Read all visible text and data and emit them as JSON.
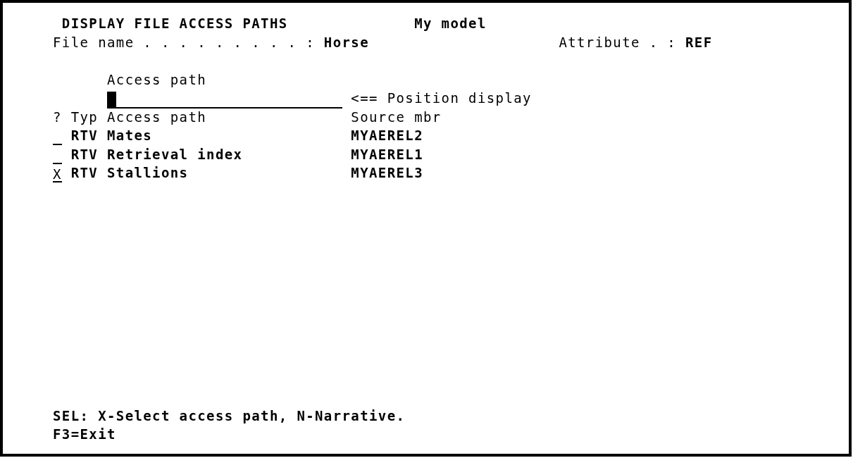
{
  "screen": {
    "title": "DISPLAY FILE ACCESS PATHS",
    "model": "My model"
  },
  "file_name": {
    "label": "File name . . . . . . . . . :",
    "value": "Horse"
  },
  "attribute": {
    "label": "Attribute . :",
    "value": "REF"
  },
  "position": {
    "label": "Access path",
    "focused": true,
    "hint": "<== Position display"
  },
  "table": {
    "columns": [
      "?",
      "Typ",
      "Access path",
      "Source mbr"
    ],
    "rows": [
      {
        "type": "RTV",
        "access_path": "Mates",
        "source_member": "MYAEREL2"
      },
      {
        "type": "RTV",
        "access_path": "Retrieval index",
        "source_member": "MYAEREL1"
      },
      {
        "option": "X",
        "type": "RTV",
        "access_path": "Stallions",
        "source_member": "MYAEREL3"
      }
    ]
  },
  "footer": {
    "help": "SEL: X-Select access path, N-Narrative.",
    "keys": "F3=Exit"
  }
}
